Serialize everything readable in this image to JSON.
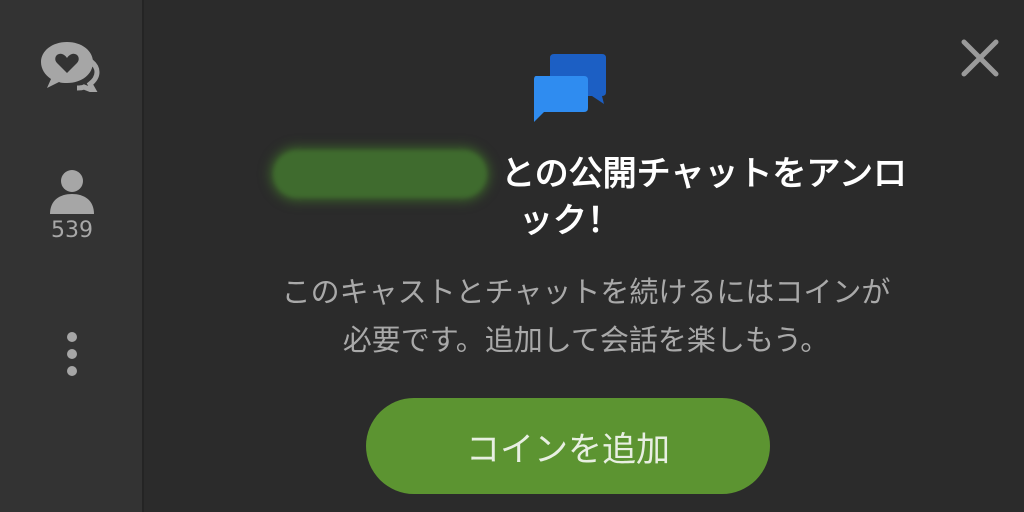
{
  "sidebar": {
    "viewer_count": "539"
  },
  "dialog": {
    "title_line1": "との公開チャットをアンロ",
    "title_line2": "ック！",
    "description_line1": "このキャストとチャットを続けるにはコインが",
    "description_line2": "必要です。追加して会話を楽しもう。",
    "button_label": "コインを追加"
  },
  "colors": {
    "background": "#2b2b2b",
    "sidebar": "#333333",
    "button": "#5c9431",
    "logo_light": "#2f8cf0",
    "logo_dark": "#1c5fc4"
  },
  "icons": {
    "chat": "heart-chat-icon",
    "viewers": "person-icon",
    "more": "vertical-dots-icon",
    "close": "close-icon",
    "logo": "chat-bubbles-logo"
  }
}
